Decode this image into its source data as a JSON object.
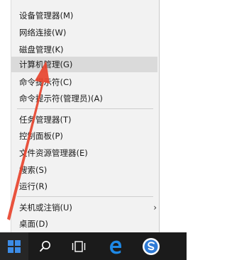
{
  "menu": {
    "items": [
      {
        "label": "设备管理器(M)"
      },
      {
        "label": "网络连接(W)"
      },
      {
        "label": "磁盘管理(K)"
      },
      {
        "label": "计算机管理(G)"
      },
      {
        "label": "命令提示符(C)"
      },
      {
        "label": "命令提示符(管理员)(A)"
      },
      {
        "label": "任务管理器(T)"
      },
      {
        "label": "控制面板(P)"
      },
      {
        "label": "文件资源管理器(E)"
      },
      {
        "label": "搜索(S)"
      },
      {
        "label": "运行(R)"
      },
      {
        "label": "关机或注销(U)"
      },
      {
        "label": "桌面(D)"
      }
    ],
    "highlighted_index": 3
  },
  "taskbar": {
    "icons": [
      "windows-start-icon",
      "search-icon",
      "task-view-icon",
      "edge-browser-icon",
      "sogou-app-icon"
    ],
    "colors": {
      "background": "#1b1b1b",
      "start": "#3c8ce6",
      "edge": "#1e88e5",
      "sogou": "#2f7bd6"
    }
  },
  "annotation": {
    "color": "#e8442e"
  }
}
